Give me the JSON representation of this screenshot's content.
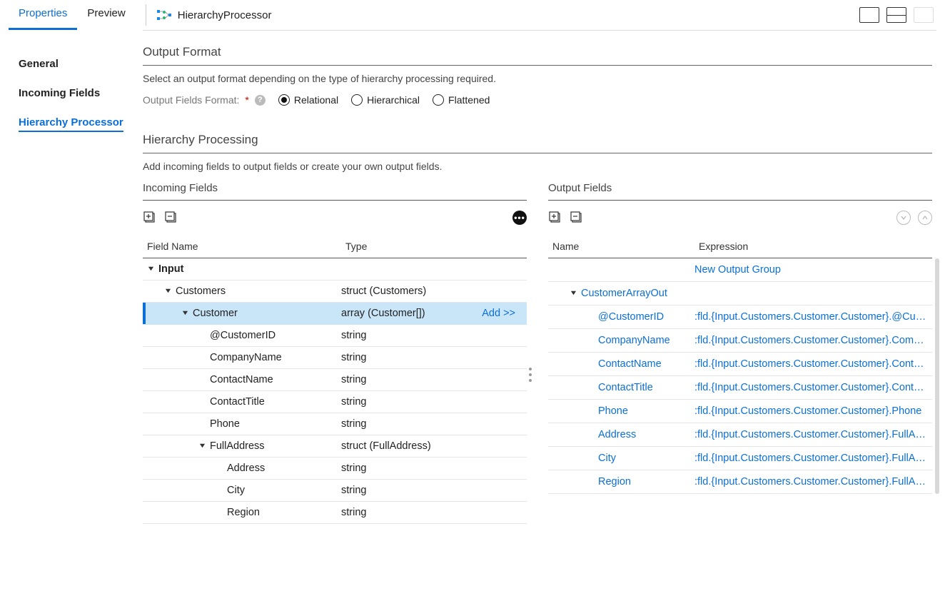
{
  "top": {
    "tabs": [
      "Properties",
      "Preview"
    ],
    "active": 0,
    "processorName": "HierarchyProcessor"
  },
  "sidebar": {
    "items": [
      "General",
      "Incoming Fields",
      "Hierarchy Processor"
    ],
    "active": 2
  },
  "outputFormat": {
    "title": "Output Format",
    "desc": "Select an output format depending on the type of hierarchy processing required.",
    "fieldLabel": "Output Fields Format:",
    "options": [
      "Relational",
      "Hierarchical",
      "Flattened"
    ],
    "selected": 0
  },
  "hierarchyProcessing": {
    "title": "Hierarchy Processing",
    "desc": "Add incoming fields to output fields or create your own output fields."
  },
  "incoming": {
    "title": "Incoming Fields",
    "headers": {
      "name": "Field Name",
      "type": "Type"
    },
    "addLabel": "Add >>",
    "rows": [
      {
        "name": "Input",
        "type": "",
        "indent": 0,
        "caret": true,
        "bold": true
      },
      {
        "name": "Customers",
        "type": "struct (Customers)",
        "indent": 1,
        "caret": true
      },
      {
        "name": "Customer",
        "type": "array (Customer[])",
        "indent": 2,
        "caret": true,
        "selected": true,
        "action": true
      },
      {
        "name": "@CustomerID",
        "type": "string",
        "indent": 3
      },
      {
        "name": "CompanyName",
        "type": "string",
        "indent": 3
      },
      {
        "name": "ContactName",
        "type": "string",
        "indent": 3
      },
      {
        "name": "ContactTitle",
        "type": "string",
        "indent": 3
      },
      {
        "name": "Phone",
        "type": "string",
        "indent": 3
      },
      {
        "name": "FullAddress",
        "type": "struct (FullAddress)",
        "indent": 3,
        "caret": true
      },
      {
        "name": "Address",
        "type": "string",
        "indent": 4
      },
      {
        "name": "City",
        "type": "string",
        "indent": 4
      },
      {
        "name": "Region",
        "type": "string",
        "indent": 4
      }
    ]
  },
  "output": {
    "title": "Output Fields",
    "headers": {
      "name": "Name",
      "expr": "Expression"
    },
    "newGroupLabel": "New Output Group",
    "rows": [
      {
        "name": "CustomerArrayOut",
        "expr": "",
        "indent": 1,
        "caret": true,
        "group": true
      },
      {
        "name": "@CustomerID",
        "expr": ":fld.{Input.Customers.Customer.Customer}.@Cus…",
        "indent": 2
      },
      {
        "name": "CompanyName",
        "expr": ":fld.{Input.Customers.Customer.Customer}.Com…",
        "indent": 2
      },
      {
        "name": "ContactName",
        "expr": ":fld.{Input.Customers.Customer.Customer}.Cont…",
        "indent": 2
      },
      {
        "name": "ContactTitle",
        "expr": ":fld.{Input.Customers.Customer.Customer}.Cont…",
        "indent": 2
      },
      {
        "name": "Phone",
        "expr": ":fld.{Input.Customers.Customer.Customer}.Phone",
        "indent": 2
      },
      {
        "name": "Address",
        "expr": ":fld.{Input.Customers.Customer.Customer}.FullA…",
        "indent": 2
      },
      {
        "name": "City",
        "expr": ":fld.{Input.Customers.Customer.Customer}.FullA…",
        "indent": 2
      },
      {
        "name": "Region",
        "expr": ":fld.{Input.Customers.Customer.Customer}.FullA…",
        "indent": 2
      }
    ]
  }
}
